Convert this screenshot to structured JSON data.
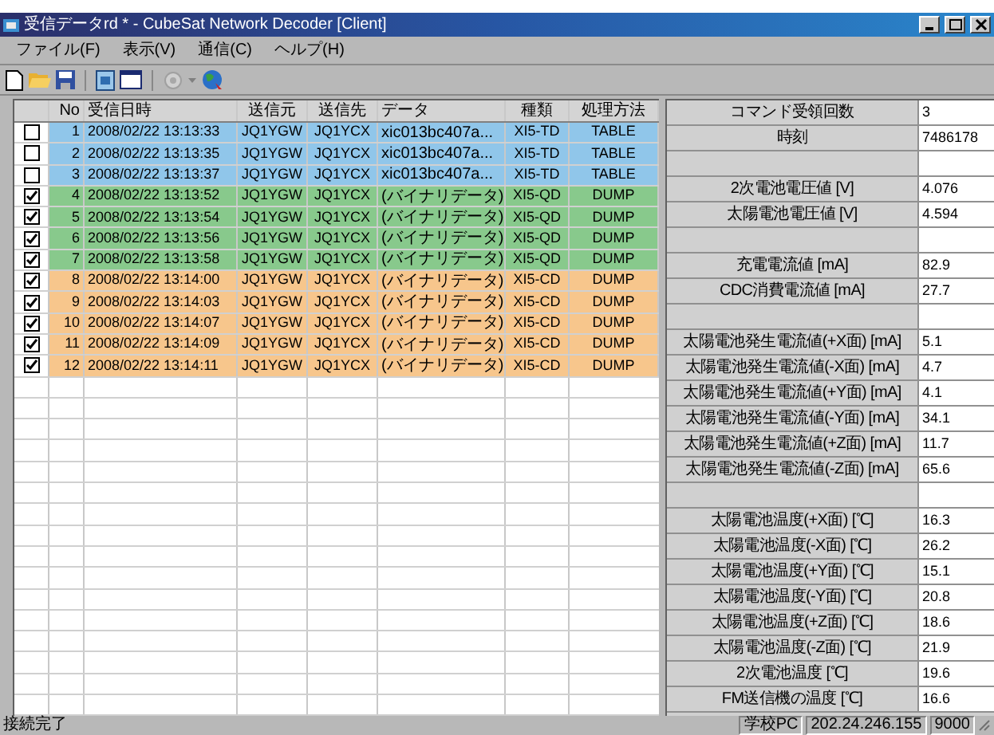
{
  "window": {
    "title": "受信データrd * - CubeSat Network Decoder [Client]"
  },
  "menu": [
    "ファイル(F)",
    "表示(V)",
    "通信(C)",
    "ヘルプ(H)"
  ],
  "table": {
    "columns": [
      "No",
      "受信日時",
      "送信元",
      "送信先",
      "データ",
      "種類",
      "処理方法"
    ],
    "rows": [
      {
        "checked": false,
        "color": "#90c6ea",
        "cells": [
          "1",
          "2008/02/22 13:13:33",
          "JQ1YGW",
          "JQ1YCX",
          "xic013bc407a...",
          "XI5-TD",
          "TABLE"
        ]
      },
      {
        "checked": false,
        "color": "#90c6ea",
        "cells": [
          "2",
          "2008/02/22 13:13:35",
          "JQ1YGW",
          "JQ1YCX",
          "xic013bc407a...",
          "XI5-TD",
          "TABLE"
        ]
      },
      {
        "checked": false,
        "color": "#90c6ea",
        "cells": [
          "3",
          "2008/02/22 13:13:37",
          "JQ1YGW",
          "JQ1YCX",
          "xic013bc407a...",
          "XI5-TD",
          "TABLE"
        ]
      },
      {
        "checked": true,
        "color": "#88c98c",
        "cells": [
          "4",
          "2008/02/22 13:13:52",
          "JQ1YGW",
          "JQ1YCX",
          "(バイナリデータ)",
          "XI5-QD",
          "DUMP"
        ]
      },
      {
        "checked": true,
        "color": "#88c98c",
        "cells": [
          "5",
          "2008/02/22 13:13:54",
          "JQ1YGW",
          "JQ1YCX",
          "(バイナリデータ)",
          "XI5-QD",
          "DUMP"
        ]
      },
      {
        "checked": true,
        "color": "#88c98c",
        "cells": [
          "6",
          "2008/02/22 13:13:56",
          "JQ1YGW",
          "JQ1YCX",
          "(バイナリデータ)",
          "XI5-QD",
          "DUMP"
        ]
      },
      {
        "checked": true,
        "color": "#88c98c",
        "cells": [
          "7",
          "2008/02/22 13:13:58",
          "JQ1YGW",
          "JQ1YCX",
          "(バイナリデータ)",
          "XI5-QD",
          "DUMP"
        ]
      },
      {
        "checked": true,
        "color": "#f7c68c",
        "cells": [
          "8",
          "2008/02/22 13:14:00",
          "JQ1YGW",
          "JQ1YCX",
          "(バイナリデータ)",
          "XI5-CD",
          "DUMP"
        ]
      },
      {
        "checked": true,
        "color": "#f7c68c",
        "cells": [
          "9",
          "2008/02/22 13:14:03",
          "JQ1YGW",
          "JQ1YCX",
          "(バイナリデータ)",
          "XI5-CD",
          "DUMP"
        ]
      },
      {
        "checked": true,
        "color": "#f7c68c",
        "cells": [
          "10",
          "2008/02/22 13:14:07",
          "JQ1YGW",
          "JQ1YCX",
          "(バイナリデータ)",
          "XI5-CD",
          "DUMP"
        ]
      },
      {
        "checked": true,
        "color": "#f7c68c",
        "cells": [
          "11",
          "2008/02/22 13:14:09",
          "JQ1YGW",
          "JQ1YCX",
          "(バイナリデータ)",
          "XI5-CD",
          "DUMP"
        ]
      },
      {
        "checked": true,
        "color": "#f7c68c",
        "cells": [
          "12",
          "2008/02/22 13:14:11",
          "JQ1YGW",
          "JQ1YCX",
          "(バイナリデータ)",
          "XI5-CD",
          "DUMP"
        ]
      }
    ]
  },
  "property_groups": [
    [
      {
        "label": "コマンド受領回数",
        "value": "3"
      },
      {
        "label": "時刻",
        "value": "7486178"
      }
    ],
    [
      {
        "label": "2次電池電圧値 [V]",
        "value": "4.076"
      },
      {
        "label": "太陽電池電圧値 [V]",
        "value": "4.594"
      }
    ],
    [
      {
        "label": "充電電流値 [mA]",
        "value": "82.9"
      },
      {
        "label": "CDC消費電流値 [mA]",
        "value": "27.7"
      }
    ],
    [
      {
        "label": "太陽電池発生電流値(+X面) [mA]",
        "value": "5.1"
      },
      {
        "label": "太陽電池発生電流値(-X面) [mA]",
        "value": "4.7"
      },
      {
        "label": "太陽電池発生電流値(+Y面) [mA]",
        "value": "4.1"
      },
      {
        "label": "太陽電池発生電流値(-Y面) [mA]",
        "value": "34.1"
      },
      {
        "label": "太陽電池発生電流値(+Z面) [mA]",
        "value": "11.7"
      },
      {
        "label": "太陽電池発生電流値(-Z面) [mA]",
        "value": "65.6"
      }
    ],
    [
      {
        "label": "太陽電池温度(+X面) [℃]",
        "value": "16.3"
      },
      {
        "label": "太陽電池温度(-X面) [℃]",
        "value": "26.2"
      },
      {
        "label": "太陽電池温度(+Y面) [℃]",
        "value": "15.1"
      },
      {
        "label": "太陽電池温度(-Y面) [℃]",
        "value": "20.8"
      },
      {
        "label": "太陽電池温度(+Z面) [℃]",
        "value": "18.6"
      },
      {
        "label": "太陽電池温度(-Z面) [℃]",
        "value": "21.9"
      },
      {
        "label": "2次電池温度 [℃]",
        "value": "19.6"
      },
      {
        "label": "FM送信機の温度 [℃]",
        "value": "16.6"
      }
    ]
  ],
  "status_bar": {
    "message": "接続完了",
    "panels": [
      "学校PC",
      "202.24.246.155",
      "9000"
    ]
  }
}
